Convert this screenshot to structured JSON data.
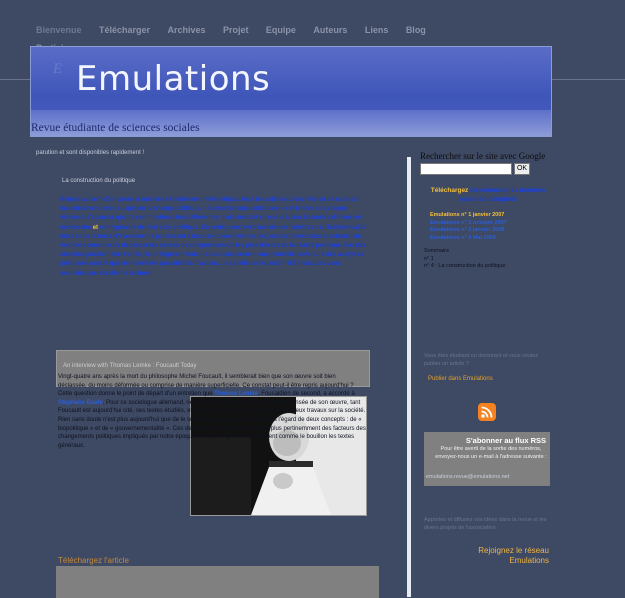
{
  "nav": {
    "items": [
      "Bienvenue",
      "Télécharger",
      "Archives",
      "Projet",
      "Equipe",
      "Auteurs",
      "Liens",
      "Blog",
      "Participer"
    ]
  },
  "banner": {
    "title": "Emulations",
    "subtitle": "Revue étudiante de sciences sociales"
  },
  "main": {
    "snippet": "parution et sont disponibles rapidement !",
    "construction_label": "La construction du politique",
    "intro_before": "Réunis au sein d'un premier numéro véritablement thématique, tous les articles présentés en ce mois de mai observent avec suspicion le champ politique. « Constructions politiques » est le titre sous lequel viennent s'agencer quatre contributions très différentes mais mettant chacune à jour la double dimension nécessaire ",
    "intro_highlight": "et",
    "intro_after": " configurante de tout acte politique. En soulignant avec insistance l'arbitraire à l'intellectualité mise sous la force d'événements paraissant s'imposer d'eux-mêmes, les jeunes chercheurs montrent leur volonté commune de dépasser les cadres de compréhension les plus directs de la réalité politique. Par des chemins pourtant fort variés, ils préfigurent tous – sous l'empereur – une nouvelle ouverture des analyses politiques autant que de nouvelles possibilités d'action. Le comité de rédaction d'Emulations vous souhaite une excellente lecture !",
    "interview_label": "An interview with Thomas Lemke : Foucault Today",
    "article_p1": "Vingt-quatre ans après la mort du philosophe Michel Foucault, il semblerait bien que son œuvre soit bien déclassée, du moins déformée ou comprise de manière superficielle. Ce constat peut-il être repris aujourd'hui ? Cette question donne le point de départ d'un entretien que",
    "article_link1": "Thomas Lemke",
    "article_p2": ", Foucaldien de second, a accordé à",
    "article_link2": "Stéphane Baele",
    "article_p3": ". Pour ce sociologue allemand, rien n'est finalement moins vrai que la pensée de son œuvre, tant Foucault est aujourd'hui cité, ses textes étudiés, et sa pensée facilitée à travers de nombreux travaux sur la société. Rien sans doute n'est plus aujourd'hui que de le suivre les penseurs de Foucault à l'égard de deux concepts : de « biopolitique » et de « gouvernementalité ». Ces derniers permettent peut-être le plus pertinemment des facteurs des changements politiques impliqués par notre époque et nous baignent actuellement comme le bouillon les textes généraux.",
    "download_label": "Téléchargez l'article"
  },
  "sidebar": {
    "search_label": "Rechercher sur le site avec Google",
    "search_button": "OK",
    "lead_prefix": "Téléchargez",
    "lead_text": " directement les derniers numéros complets",
    "issues": [
      "Emulations n° 1 janvier 2007",
      "Emulations n° 2 octobre 2007",
      "Emulations n° 3 janvier 2008",
      "Emulations n° 4 Mai 2008"
    ],
    "sommaire_label": "Sommaire",
    "sommaire_line1": "n° 1",
    "sommaire_line2": "n° 4 : La construction du politique",
    "note1": "Vous êtes étudiant ou doctorant et vous voulez publier un article ?",
    "publier_label": "Publier dans Emulations",
    "rss_title": "S'abonner au flux RSS",
    "rss_text": "Pour être averti de la sortie des numéros, envoyez-nous un e-mail à l'adresse suivante :",
    "rss_email": "emulations.revue@emulations.net",
    "note2": "Apportez et diffusez vos idées dans la revue et les divers projets de l'association",
    "join_line1": "Rejoignez le réseau",
    "join_line2": "Emulations"
  }
}
